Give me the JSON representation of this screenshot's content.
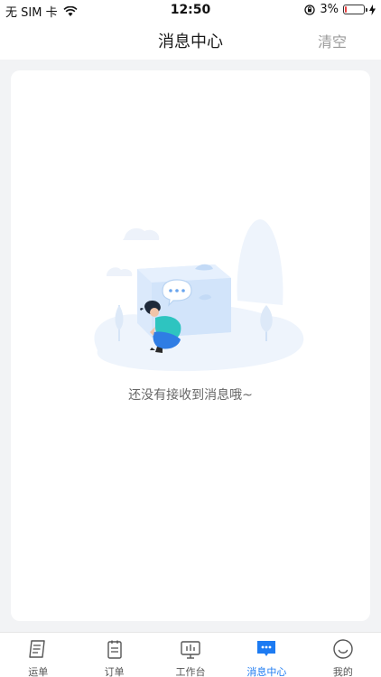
{
  "status_bar": {
    "carrier": "无 SIM 卡",
    "time": "12:50",
    "battery": "3%",
    "battery_level": 0.03
  },
  "nav": {
    "title": "消息中心",
    "clear_label": "清空"
  },
  "empty_state": {
    "message": "还没有接收到消息哦~"
  },
  "tabs": [
    {
      "label": "运单",
      "icon": "waybill-icon",
      "active": false
    },
    {
      "label": "订单",
      "icon": "order-clipboard-icon",
      "active": false
    },
    {
      "label": "工作台",
      "icon": "workbench-icon",
      "active": false
    },
    {
      "label": "消息中心",
      "icon": "message-icon",
      "active": true
    },
    {
      "label": "我的",
      "icon": "profile-smile-icon",
      "active": false
    }
  ],
  "colors": {
    "accent": "#1d7bf2",
    "background": "#f2f3f5",
    "battery_low": "#e84040"
  }
}
